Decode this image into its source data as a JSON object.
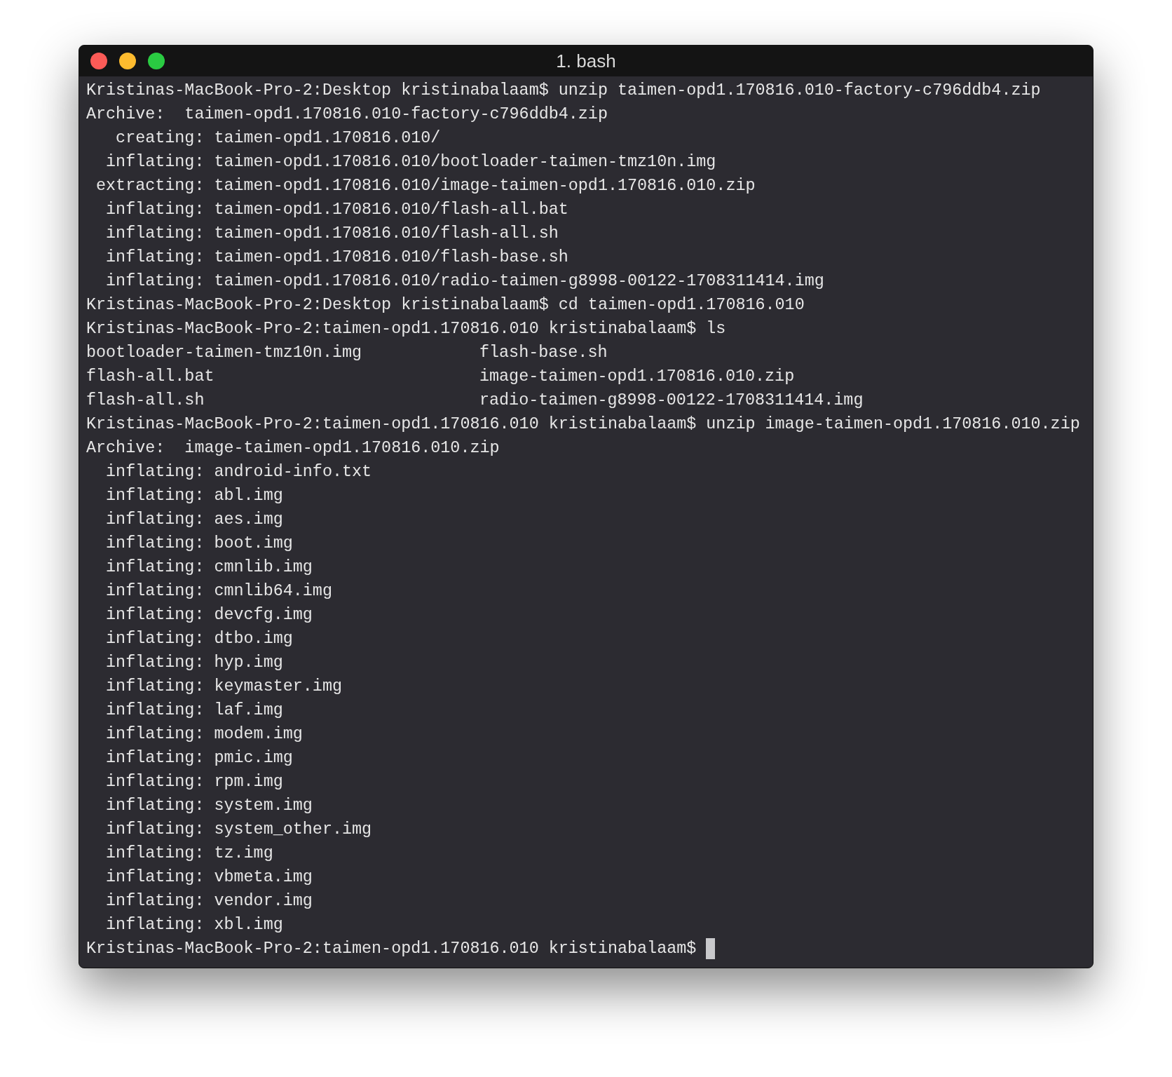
{
  "window": {
    "title": "1. bash"
  },
  "terminal": {
    "lines": [
      {
        "kind": "text",
        "text": "Kristinas-MacBook-Pro-2:Desktop kristinabalaam$ unzip taimen-opd1.170816.010-factory-c796ddb4.zip"
      },
      {
        "kind": "text",
        "text": "Archive:  taimen-opd1.170816.010-factory-c796ddb4.zip"
      },
      {
        "kind": "text",
        "text": "   creating: taimen-opd1.170816.010/"
      },
      {
        "kind": "text",
        "text": "  inflating: taimen-opd1.170816.010/bootloader-taimen-tmz10n.img"
      },
      {
        "kind": "text",
        "text": " extracting: taimen-opd1.170816.010/image-taimen-opd1.170816.010.zip"
      },
      {
        "kind": "text",
        "text": "  inflating: taimen-opd1.170816.010/flash-all.bat"
      },
      {
        "kind": "text",
        "text": "  inflating: taimen-opd1.170816.010/flash-all.sh"
      },
      {
        "kind": "text",
        "text": "  inflating: taimen-opd1.170816.010/flash-base.sh"
      },
      {
        "kind": "text",
        "text": "  inflating: taimen-opd1.170816.010/radio-taimen-g8998-00122-1708311414.img"
      },
      {
        "kind": "text",
        "text": "Kristinas-MacBook-Pro-2:Desktop kristinabalaam$ cd taimen-opd1.170816.010"
      },
      {
        "kind": "text",
        "text": "Kristinas-MacBook-Pro-2:taimen-opd1.170816.010 kristinabalaam$ ls"
      },
      {
        "kind": "columns",
        "cells": [
          "bootloader-taimen-tmz10n.img",
          "flash-base.sh"
        ]
      },
      {
        "kind": "columns",
        "cells": [
          "flash-all.bat",
          "image-taimen-opd1.170816.010.zip"
        ]
      },
      {
        "kind": "columns",
        "cells": [
          "flash-all.sh",
          "radio-taimen-g8998-00122-1708311414.img"
        ]
      },
      {
        "kind": "text",
        "text": "Kristinas-MacBook-Pro-2:taimen-opd1.170816.010 kristinabalaam$ unzip image-taimen-opd1.170816.010.zip"
      },
      {
        "kind": "text",
        "text": "Archive:  image-taimen-opd1.170816.010.zip"
      },
      {
        "kind": "text",
        "text": "  inflating: android-info.txt"
      },
      {
        "kind": "text",
        "text": "  inflating: abl.img"
      },
      {
        "kind": "text",
        "text": "  inflating: aes.img"
      },
      {
        "kind": "text",
        "text": "  inflating: boot.img"
      },
      {
        "kind": "text",
        "text": "  inflating: cmnlib.img"
      },
      {
        "kind": "text",
        "text": "  inflating: cmnlib64.img"
      },
      {
        "kind": "text",
        "text": "  inflating: devcfg.img"
      },
      {
        "kind": "text",
        "text": "  inflating: dtbo.img"
      },
      {
        "kind": "text",
        "text": "  inflating: hyp.img"
      },
      {
        "kind": "text",
        "text": "  inflating: keymaster.img"
      },
      {
        "kind": "text",
        "text": "  inflating: laf.img"
      },
      {
        "kind": "text",
        "text": "  inflating: modem.img"
      },
      {
        "kind": "text",
        "text": "  inflating: pmic.img"
      },
      {
        "kind": "text",
        "text": "  inflating: rpm.img"
      },
      {
        "kind": "text",
        "text": "  inflating: system.img"
      },
      {
        "kind": "text",
        "text": "  inflating: system_other.img"
      },
      {
        "kind": "text",
        "text": "  inflating: tz.img"
      },
      {
        "kind": "text",
        "text": "  inflating: vbmeta.img"
      },
      {
        "kind": "text",
        "text": "  inflating: vendor.img"
      },
      {
        "kind": "text",
        "text": "  inflating: xbl.img"
      },
      {
        "kind": "prompt",
        "text": "Kristinas-MacBook-Pro-2:taimen-opd1.170816.010 kristinabalaam$"
      }
    ]
  }
}
